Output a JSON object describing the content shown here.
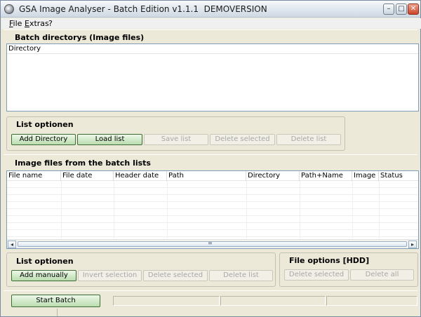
{
  "window": {
    "title": "GSA Image Analyser - Batch Edition v1.1.1  DEMOVERSION",
    "minimize_glyph": "–",
    "maximize_glyph": "□",
    "close_glyph": "✕"
  },
  "menu": {
    "items": [
      {
        "label": "File",
        "accel": "F",
        "rest": "ile"
      },
      {
        "label": "Extras",
        "accel": "E",
        "rest": "xtras"
      },
      {
        "label": "?",
        "accel": "",
        "rest": "?"
      }
    ]
  },
  "batch_section": {
    "title": "Batch directorys (Image files)",
    "list_columns": [
      "Directory"
    ]
  },
  "list_options_1": {
    "title": "List optionen",
    "buttons": [
      "Add Directory",
      "Load list",
      "Save list",
      "Delete selected",
      "Delete list"
    ]
  },
  "image_files_section": {
    "title": "Image files from the batch lists",
    "columns": [
      "File name",
      "File date",
      "Header date",
      "Path",
      "Directory",
      "Path+Name",
      "Image typ",
      "Status"
    ],
    "scroll_left": "◂",
    "scroll_right": "▸",
    "scroll_grip": "≡"
  },
  "list_options_2": {
    "title": "List optionen",
    "buttons": [
      "Add manually",
      "Invert selection",
      "Delete selected",
      "Delete list"
    ]
  },
  "file_options": {
    "title": "File options [HDD]",
    "buttons": [
      "Delete selected",
      "Delete all"
    ]
  },
  "bottom": {
    "start_label": "Start Batch"
  },
  "colors": {
    "window_bg": "#ece9d8",
    "primary_button_border": "#3d6b35",
    "list_border": "#7f9db9"
  }
}
